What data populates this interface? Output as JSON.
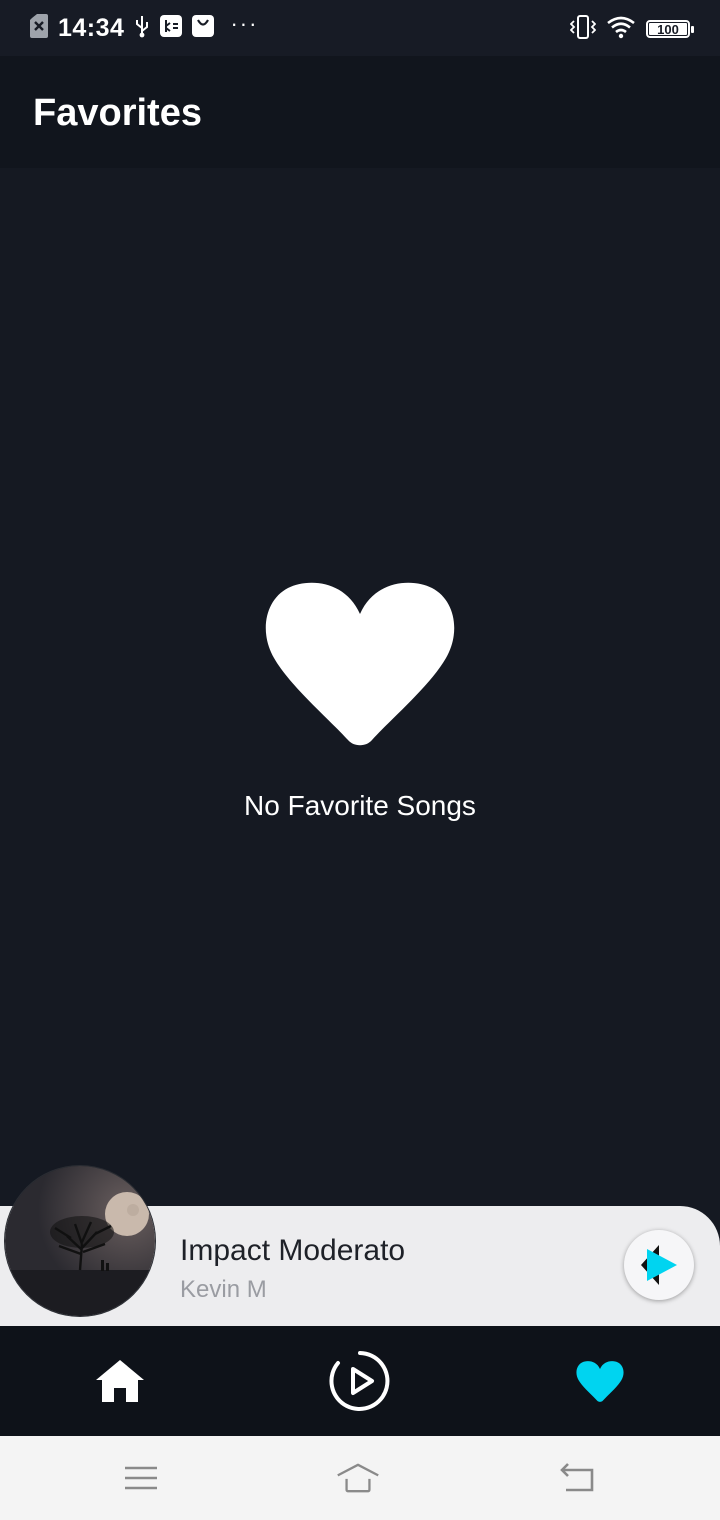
{
  "status_bar": {
    "time": "14:34",
    "battery": "100",
    "battery_level": 1.0
  },
  "app_bar": {
    "title": "Favorites"
  },
  "empty_state": {
    "icon": "heart-icon",
    "message": "No Favorite Songs"
  },
  "mini_player": {
    "title": "Impact Moderato",
    "artist": "Kevin M",
    "play_icon": "play-icon"
  },
  "bottom_nav": {
    "items": [
      {
        "icon": "home-icon",
        "active": false
      },
      {
        "icon": "now-playing-icon",
        "active": false
      },
      {
        "icon": "favorites-heart-icon",
        "active": true
      }
    ],
    "active_color": "#00d4f0"
  },
  "system_nav": {
    "items": [
      {
        "icon": "menu-icon"
      },
      {
        "icon": "home-icon"
      },
      {
        "icon": "back-icon"
      }
    ]
  },
  "colors": {
    "background": "#151922",
    "app_bar": "#11151d",
    "accent": "#00d4f0",
    "mini_player": "#ededef"
  }
}
